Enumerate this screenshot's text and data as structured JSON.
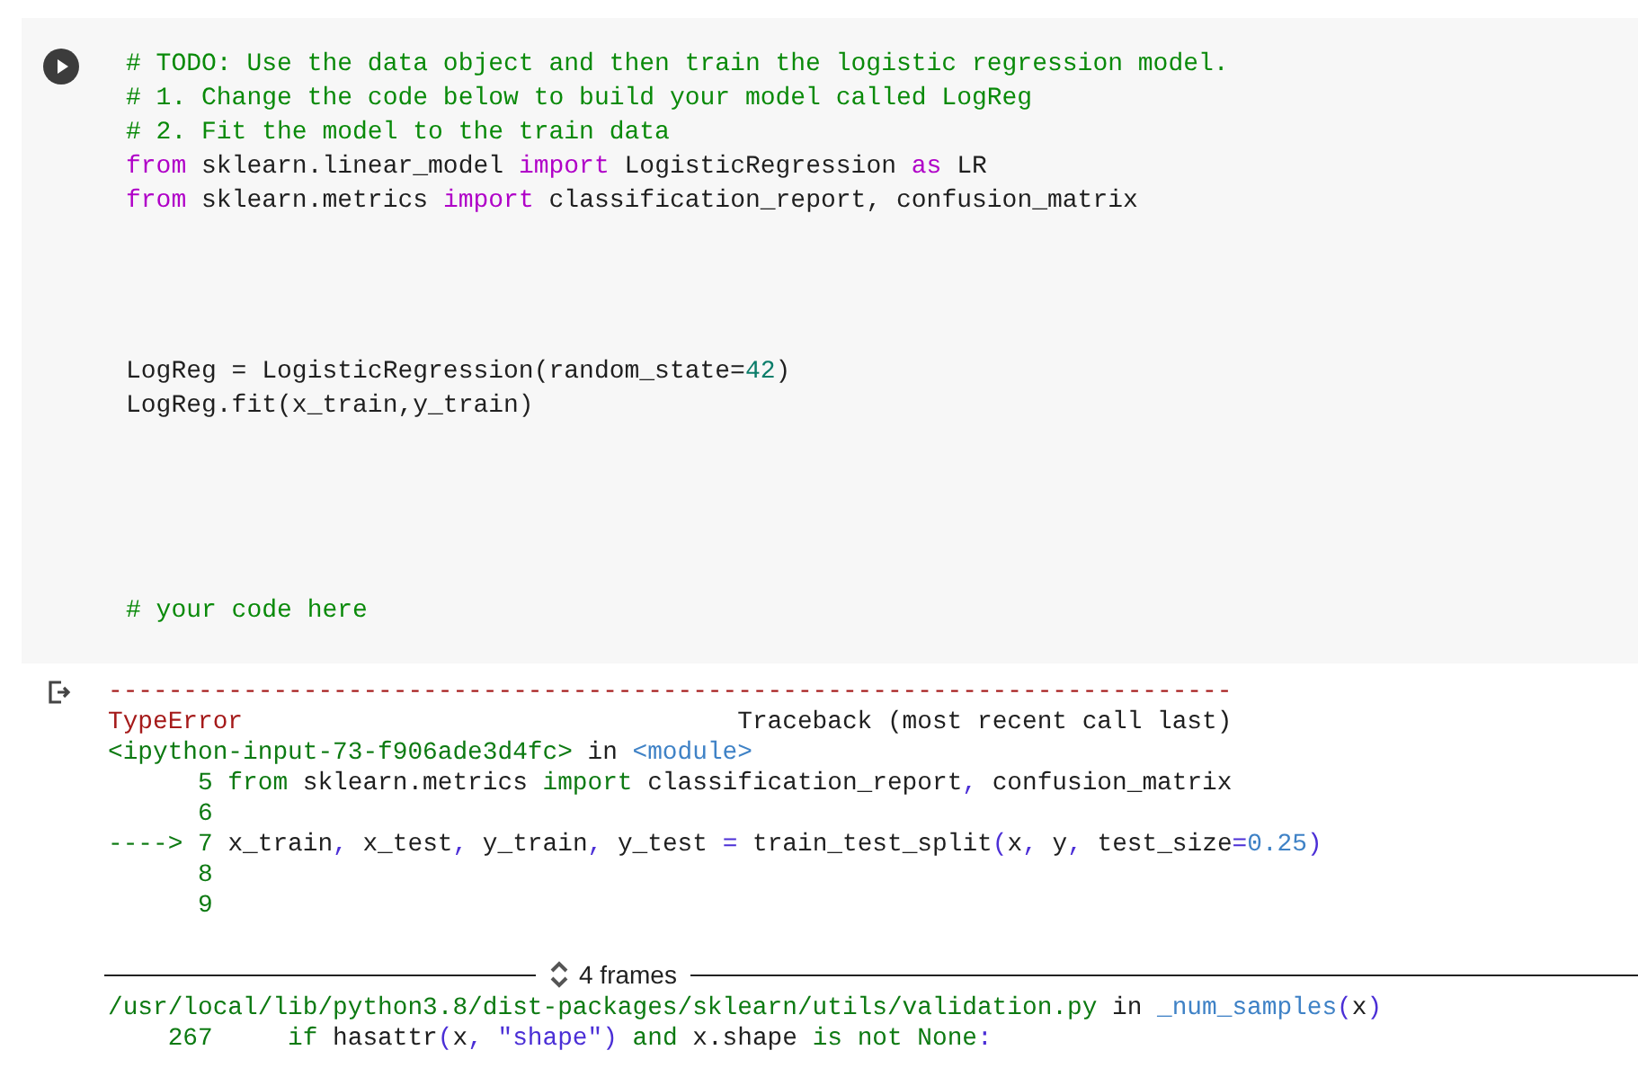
{
  "code_cell": {
    "lines": [
      {
        "kind": "code",
        "tokens": [
          {
            "kind": "comment",
            "text": "# TODO: Use the data object and then train the logistic regression model."
          }
        ]
      },
      {
        "kind": "code",
        "tokens": [
          {
            "kind": "comment",
            "text": "# 1. Change the code below to build your model called LogReg"
          }
        ]
      },
      {
        "kind": "code",
        "tokens": [
          {
            "kind": "comment",
            "text": "# 2. Fit the model to the train data"
          }
        ]
      },
      {
        "kind": "code",
        "tokens": [
          {
            "kind": "keyword",
            "text": "from"
          },
          {
            "kind": "plain",
            "text": " sklearn.linear_model "
          },
          {
            "kind": "keyword",
            "text": "import"
          },
          {
            "kind": "plain",
            "text": " LogisticRegression "
          },
          {
            "kind": "keyword",
            "text": "as"
          },
          {
            "kind": "plain",
            "text": " LR"
          }
        ]
      },
      {
        "kind": "code",
        "tokens": [
          {
            "kind": "keyword",
            "text": "from"
          },
          {
            "kind": "plain",
            "text": " sklearn.metrics "
          },
          {
            "kind": "keyword",
            "text": "import"
          },
          {
            "kind": "plain",
            "text": " classification_report, confusion_matrix"
          }
        ]
      },
      {
        "kind": "blank"
      },
      {
        "kind": "blank"
      },
      {
        "kind": "blank"
      },
      {
        "kind": "blank"
      },
      {
        "kind": "code",
        "tokens": [
          {
            "kind": "plain",
            "text": "LogReg = LogisticRegression(random_state="
          },
          {
            "kind": "number",
            "text": "42"
          },
          {
            "kind": "plain",
            "text": ")"
          }
        ]
      },
      {
        "kind": "code",
        "tokens": [
          {
            "kind": "plain",
            "text": "LogReg.fit(x_train,y_train)"
          }
        ]
      },
      {
        "kind": "blank"
      },
      {
        "kind": "blank"
      },
      {
        "kind": "blank"
      },
      {
        "kind": "blank"
      },
      {
        "kind": "blank"
      },
      {
        "kind": "code",
        "tokens": [
          {
            "kind": "comment",
            "text": "# your code here"
          }
        ]
      }
    ]
  },
  "output": {
    "lines": [
      {
        "kind": "code",
        "tokens": [
          {
            "kind": "error",
            "text": "---------------------------------------------------------------------------"
          }
        ]
      },
      {
        "kind": "code",
        "tokens": [
          {
            "kind": "error",
            "text": "TypeError"
          },
          {
            "kind": "plain",
            "text": "                                 Traceback (most recent call last)"
          }
        ]
      },
      {
        "kind": "code",
        "tokens": [
          {
            "kind": "green",
            "text": "<ipython-input-73-f906ade3d4fc>"
          },
          {
            "kind": "plain",
            "text": " in "
          },
          {
            "kind": "name",
            "text": "<module>"
          }
        ]
      },
      {
        "kind": "code",
        "tokens": [
          {
            "kind": "green",
            "text": "      5 from"
          },
          {
            "kind": "plain",
            "text": " sklearn.metrics "
          },
          {
            "kind": "green",
            "text": "import"
          },
          {
            "kind": "plain",
            "text": " classification_report"
          },
          {
            "kind": "punct",
            "text": ","
          },
          {
            "kind": "plain",
            "text": " confusion_matrix"
          }
        ]
      },
      {
        "kind": "code",
        "tokens": [
          {
            "kind": "green",
            "text": "      6"
          }
        ]
      },
      {
        "kind": "code",
        "tokens": [
          {
            "kind": "green",
            "text": "----> 7 "
          },
          {
            "kind": "plain",
            "text": "x_train"
          },
          {
            "kind": "punct",
            "text": ","
          },
          {
            "kind": "plain",
            "text": " x_test"
          },
          {
            "kind": "punct",
            "text": ","
          },
          {
            "kind": "plain",
            "text": " y_train"
          },
          {
            "kind": "punct",
            "text": ","
          },
          {
            "kind": "plain",
            "text": " y_test "
          },
          {
            "kind": "punct",
            "text": "="
          },
          {
            "kind": "plain",
            "text": " train_test_split"
          },
          {
            "kind": "punct",
            "text": "("
          },
          {
            "kind": "plain",
            "text": "x"
          },
          {
            "kind": "punct",
            "text": ","
          },
          {
            "kind": "plain",
            "text": " y"
          },
          {
            "kind": "punct",
            "text": ","
          },
          {
            "kind": "plain",
            "text": " test_size"
          },
          {
            "kind": "punct",
            "text": "="
          },
          {
            "kind": "name",
            "text": "0.25"
          },
          {
            "kind": "punct",
            "text": ")"
          }
        ]
      },
      {
        "kind": "code",
        "tokens": [
          {
            "kind": "green",
            "text": "      8"
          }
        ]
      },
      {
        "kind": "code",
        "tokens": [
          {
            "kind": "green",
            "text": "      9"
          }
        ]
      }
    ],
    "frames": {
      "label": "4 frames",
      "expanded": false
    },
    "after_lines": [
      {
        "kind": "code",
        "tokens": [
          {
            "kind": "green",
            "text": "/usr/local/lib/python3.8/dist-packages/sklearn/utils/validation.py"
          },
          {
            "kind": "plain",
            "text": " in "
          },
          {
            "kind": "name",
            "text": "_num_samples"
          },
          {
            "kind": "punct",
            "text": "("
          },
          {
            "kind": "plain",
            "text": "x"
          },
          {
            "kind": "punct",
            "text": ")"
          }
        ]
      },
      {
        "kind": "code",
        "tokens": [
          {
            "kind": "green",
            "text": "    267     if"
          },
          {
            "kind": "plain",
            "text": " hasattr"
          },
          {
            "kind": "punct",
            "text": "("
          },
          {
            "kind": "plain",
            "text": "x"
          },
          {
            "kind": "punct",
            "text": ", \"shape\")"
          },
          {
            "kind": "green",
            "text": " and"
          },
          {
            "kind": "plain",
            "text": " x.shape "
          },
          {
            "kind": "green",
            "text": "is not None"
          },
          {
            "kind": "punct",
            "text": ":"
          }
        ]
      }
    ]
  }
}
